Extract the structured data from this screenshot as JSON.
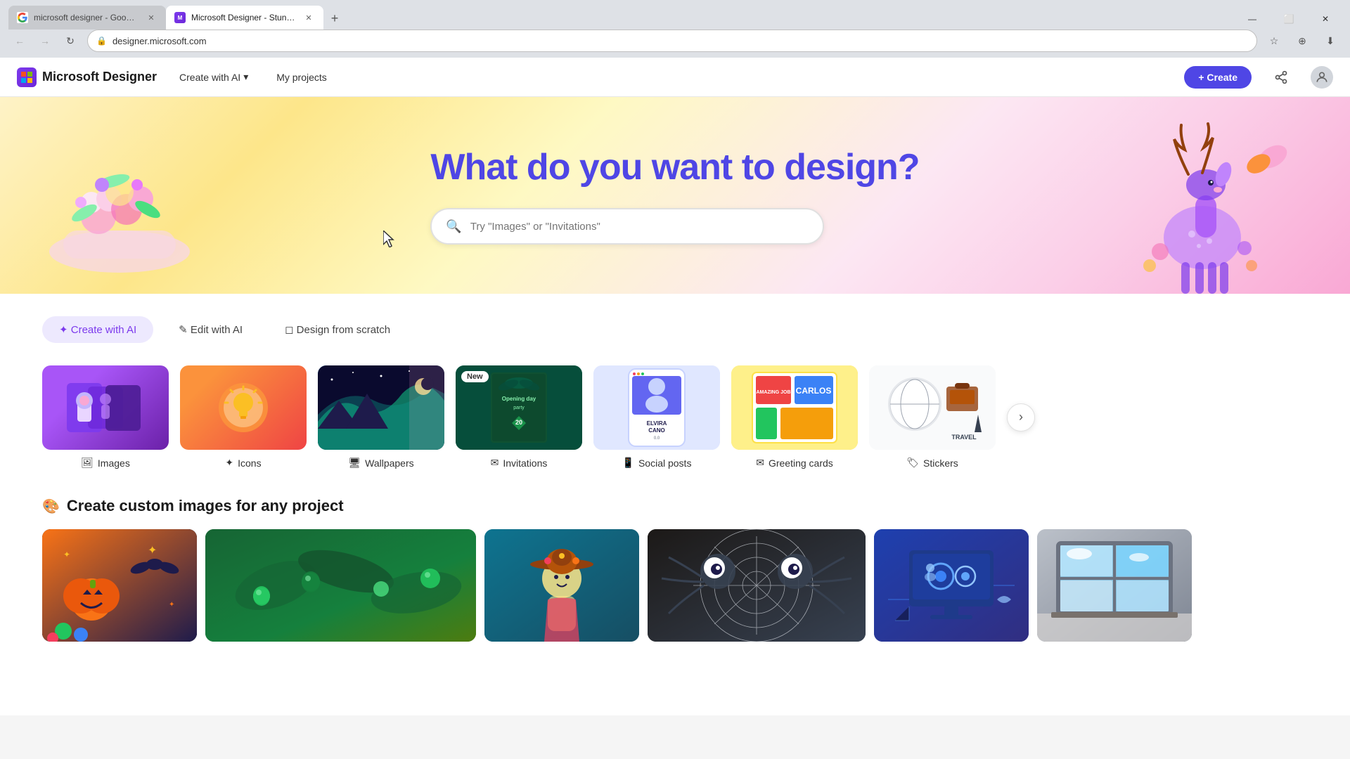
{
  "browser": {
    "tabs": [
      {
        "id": "tab1",
        "favicon": "G",
        "label": "microsoft designer - Google Se...",
        "active": false,
        "closable": true
      },
      {
        "id": "tab2",
        "favicon": "M",
        "label": "Microsoft Designer - Stunning...",
        "active": true,
        "closable": true
      }
    ],
    "new_tab_label": "+",
    "address": "designer.microsoft.com",
    "win_controls": [
      "—",
      "⬜",
      "✕"
    ]
  },
  "navbar": {
    "brand_name": "Microsoft Designer",
    "nav_items": [
      {
        "id": "create-ai",
        "label": "Create with AI",
        "has_dropdown": true
      },
      {
        "id": "my-projects",
        "label": "My projects",
        "has_dropdown": false
      }
    ],
    "create_button_label": "+ Create"
  },
  "hero": {
    "title": "What do you want to design?",
    "search_placeholder": "Try \"Images\" or \"Invitations\""
  },
  "feature_tabs": [
    {
      "id": "create-ai-tab",
      "label": "✦ Create with AI",
      "active": true
    },
    {
      "id": "edit-ai-tab",
      "label": "✎ Edit with AI",
      "active": false
    },
    {
      "id": "design-scratch-tab",
      "label": "◻ Design from scratch",
      "active": false
    }
  ],
  "categories": [
    {
      "id": "images",
      "label": "Images",
      "icon": "🖼",
      "badge": ""
    },
    {
      "id": "icons",
      "label": "Icons",
      "icon": "✦",
      "badge": ""
    },
    {
      "id": "wallpapers",
      "label": "Wallpapers",
      "icon": "🖥",
      "badge": ""
    },
    {
      "id": "invitations",
      "label": "Invitations",
      "icon": "✉",
      "badge": "New"
    },
    {
      "id": "social-posts",
      "label": "Social posts",
      "icon": "📱",
      "badge": ""
    },
    {
      "id": "greeting-cards",
      "label": "Greeting cards",
      "icon": "✉",
      "badge": ""
    },
    {
      "id": "stickers",
      "label": "Stickers",
      "icon": "🏷",
      "badge": ""
    }
  ],
  "custom_images_section": {
    "icon": "🎨",
    "title": "Create custom images for any project"
  }
}
